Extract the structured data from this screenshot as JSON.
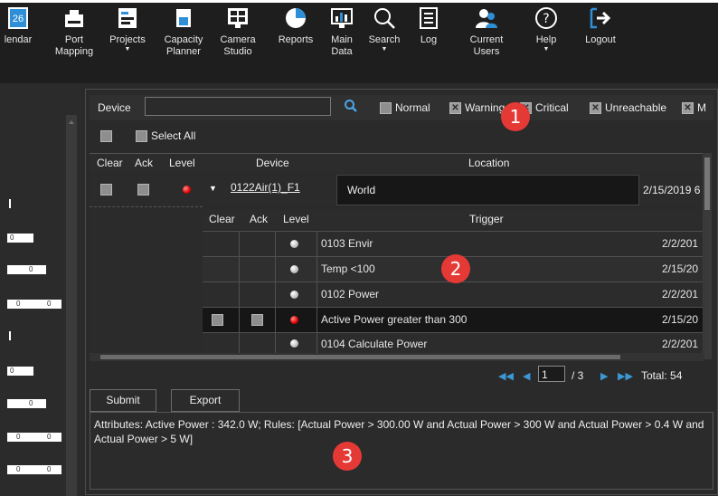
{
  "toolbar": {
    "items": [
      {
        "label": "lendar",
        "icon": "calendar-icon",
        "badge": "26"
      },
      {
        "label": "Port\nMapping",
        "icon": "port-mapping-icon"
      },
      {
        "label": "Projects",
        "icon": "projects-icon",
        "has_menu": true
      },
      {
        "label": "Capacity\nPlanner",
        "icon": "capacity-planner-icon"
      },
      {
        "label": "Camera\nStudio",
        "icon": "camera-studio-icon"
      },
      {
        "label": "Reports",
        "icon": "reports-icon"
      },
      {
        "label": "Main\nData",
        "icon": "main-data-icon",
        "has_menu": true
      },
      {
        "label": "Search",
        "icon": "search-icon",
        "has_menu": true
      },
      {
        "label": "Log",
        "icon": "log-icon"
      },
      {
        "label": "Current\nUsers",
        "icon": "current-users-icon"
      },
      {
        "label": "Help",
        "icon": "help-icon",
        "has_menu": true
      },
      {
        "label": "Logout",
        "icon": "logout-icon"
      }
    ],
    "accent": "#2f8fd6"
  },
  "filter": {
    "device_label": "Device",
    "device_value": "",
    "statuses": [
      {
        "label": "Normal",
        "checked": false
      },
      {
        "label": "Warning",
        "checked": true
      },
      {
        "label": "Critical",
        "checked": true
      },
      {
        "label": "Unreachable",
        "checked": true
      },
      {
        "label": "M",
        "checked": true
      }
    ],
    "select_all_label": "Select All"
  },
  "outer_table": {
    "headers": {
      "clear": "Clear",
      "ack": "Ack",
      "level": "Level",
      "device": "Device",
      "location": "Location"
    },
    "row": {
      "device": "0122Air(1)_F1",
      "location": "World",
      "date": "2/15/2019 6",
      "level": "red"
    }
  },
  "inner_table": {
    "headers": {
      "clear": "Clear",
      "ack": "Ack",
      "level": "Level",
      "trigger": "Trigger"
    },
    "rows": [
      {
        "trigger": "0103 Envir",
        "date": "2/2/201",
        "level": "grey",
        "checkboxes": false,
        "highlight": false
      },
      {
        "trigger": "Temp <100",
        "date": "2/15/20",
        "level": "grey",
        "checkboxes": false,
        "highlight": false
      },
      {
        "trigger": "0102 Power",
        "date": "2/2/201",
        "level": "grey",
        "checkboxes": false,
        "highlight": false
      },
      {
        "trigger": "Active Power greater than 300",
        "date": "2/15/20",
        "level": "red",
        "checkboxes": true,
        "highlight": true
      },
      {
        "trigger": "0104 Calculate Power",
        "date": "2/2/201",
        "level": "grey",
        "checkboxes": false,
        "highlight": false
      }
    ]
  },
  "pager": {
    "current": "1",
    "of": "/ 3",
    "total": "Total: 54"
  },
  "buttons": {
    "submit": "Submit",
    "export": "Export"
  },
  "attributes": "Attributes: Active Power : 342.0 W; Rules: [Actual Power > 300.00 W and Actual Power > 300 W and Actual Power > 0.4 W and Actual Power > 5 W]",
  "callouts": [
    "1",
    "2",
    "3"
  ],
  "left_panel": {
    "values": [
      "0",
      "0",
      "0",
      "0",
      "0",
      "0",
      "0",
      "0",
      "0",
      "0"
    ]
  }
}
